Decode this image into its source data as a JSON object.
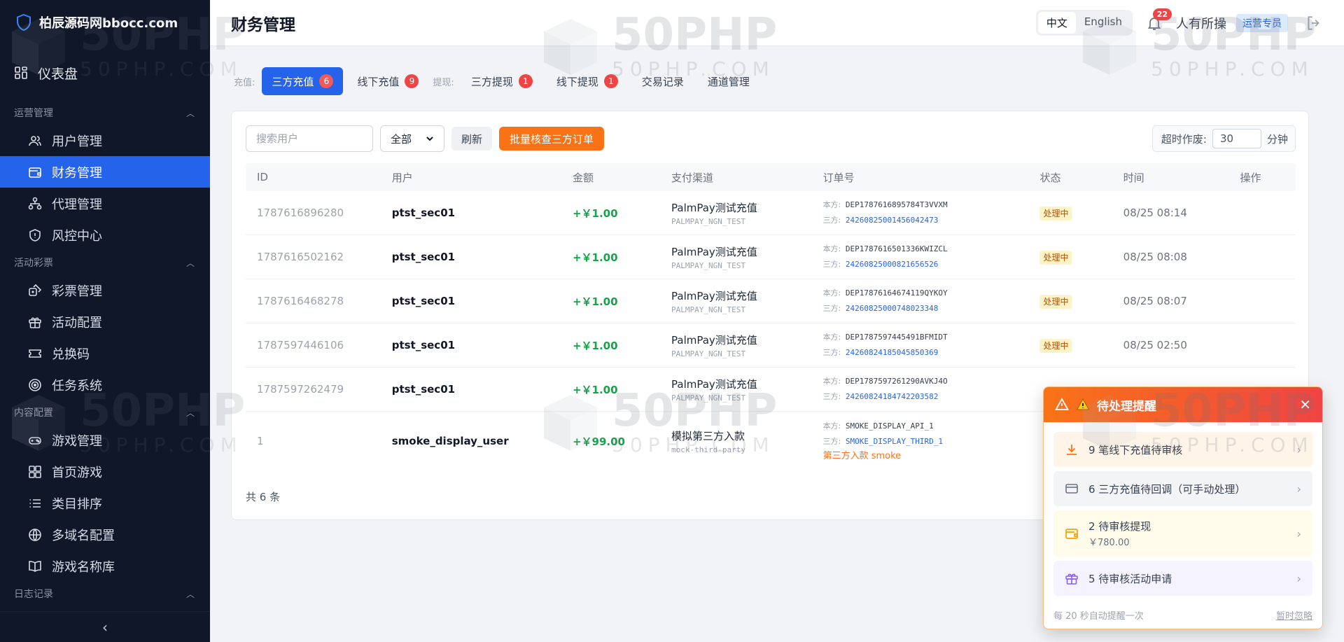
{
  "brand": {
    "name": "柏辰源码网bbocc.com"
  },
  "sidebar": {
    "dashboard": "仪表盘",
    "sections": [
      {
        "title": "运营管理",
        "items": [
          "用户管理",
          "财务管理",
          "代理管理",
          "风控中心"
        ]
      },
      {
        "title": "活动彩票",
        "items": [
          "彩票管理",
          "活动配置",
          "兑换码",
          "任务系统"
        ]
      },
      {
        "title": "内容配置",
        "items": [
          "游戏管理",
          "首页游戏",
          "类目排序",
          "多域名配置",
          "游戏名称库"
        ]
      },
      {
        "title": "日志记录",
        "items": []
      }
    ],
    "active_item": "财务管理",
    "collapse_icon": "‹"
  },
  "header": {
    "title": "财务管理",
    "lang_zh": "中文",
    "lang_en": "English",
    "notification_count": "22",
    "username": "人有所操",
    "role": "运营专员"
  },
  "tabs": {
    "recharge_label": "充值:",
    "withdraw_label": "提现:",
    "items": [
      {
        "label": "三方充值",
        "badge": "6"
      },
      {
        "label": "线下充值",
        "badge": "9"
      },
      {
        "label": "三方提现",
        "badge": "1"
      },
      {
        "label": "线下提现",
        "badge": "1"
      },
      {
        "label": "交易记录"
      },
      {
        "label": "通道管理"
      }
    ]
  },
  "toolbar": {
    "search_placeholder": "搜索用户",
    "filter_value": "全部",
    "refresh": "刷新",
    "batch_check": "批量核查三方订单",
    "timeout_label": "超时作废:",
    "timeout_value": "30",
    "timeout_unit": "分钟"
  },
  "table": {
    "columns": [
      "ID",
      "用户",
      "金额",
      "支付渠道",
      "订单号",
      "状态",
      "时间",
      "操作"
    ],
    "rows": [
      {
        "id": "1787616896280",
        "user": "ptst_sec01",
        "amount": "+￥1.00",
        "channel": "PalmPay测试充值",
        "channel_code": "PALMPAY_NGN_TEST",
        "own_prefix": "本方:",
        "own_order": "DEP1787616895784T3VVXM",
        "third_prefix": "三方:",
        "third_order": "24260825001456042473",
        "status": "处理中",
        "time": "08/25 08:14"
      },
      {
        "id": "1787616502162",
        "user": "ptst_sec01",
        "amount": "+￥1.00",
        "channel": "PalmPay测试充值",
        "channel_code": "PALMPAY_NGN_TEST",
        "own_prefix": "本方:",
        "own_order": "DEP1787616501336KWIZCL",
        "third_prefix": "三方:",
        "third_order": "24260825000821656526",
        "status": "处理中",
        "time": "08/25 08:08"
      },
      {
        "id": "1787616468278",
        "user": "ptst_sec01",
        "amount": "+￥1.00",
        "channel": "PalmPay测试充值",
        "channel_code": "PALMPAY_NGN_TEST",
        "own_prefix": "本方:",
        "own_order": "DEP17876164674119QYKOY",
        "third_prefix": "三方:",
        "third_order": "24260825000748023348",
        "status": "处理中",
        "time": "08/25 08:07"
      },
      {
        "id": "1787597446106",
        "user": "ptst_sec01",
        "amount": "+￥1.00",
        "channel": "PalmPay测试充值",
        "channel_code": "PALMPAY_NGN_TEST",
        "own_prefix": "本方:",
        "own_order": "DEP1787597445491BFMIDT",
        "third_prefix": "三方:",
        "third_order": "24260824185045850369",
        "status": "处理中",
        "time": "08/25 02:50"
      },
      {
        "id": "1787597262479",
        "user": "ptst_sec01",
        "amount": "+￥1.00",
        "channel": "PalmPay测试充值",
        "channel_code": "PALMPAY_NGN_TEST",
        "own_prefix": "本方:",
        "own_order": "DEP1787597261290AVKJ4O",
        "third_prefix": "三方:",
        "third_order": "24260824184742203582",
        "status": "",
        "time": ""
      },
      {
        "id": "1",
        "user": "smoke_display_user",
        "amount": "+￥99.00",
        "channel": "模拟第三方入款",
        "channel_code": "mock-third-party",
        "own_prefix": "本方:",
        "own_order": "SMOKE_DISPLAY_API_1",
        "third_prefix": "三方:",
        "third_order": "SMOKE_DISPLAY_THIRD_1",
        "note": "第三方入款 smoke",
        "status": "",
        "time": ""
      }
    ],
    "total": "共 6 条"
  },
  "notify": {
    "title": "待处理提醒",
    "items": [
      {
        "text": "9 笔线下充值待审核"
      },
      {
        "text": "6 三方充值待回调（可手动处理）"
      },
      {
        "text": "2 待审核提现",
        "sub": "￥780.00"
      },
      {
        "text": "5 待审核活动申请"
      }
    ],
    "footer_left": "每 20 秒自动提醒一次",
    "footer_right": "暂时忽略"
  },
  "watermark": {
    "big": "50PHP",
    "small": "50PHP.COM"
  },
  "colors": {
    "primary": "#2563eb",
    "sidebar": "#0f1729",
    "accent_orange": "#f97316",
    "success": "#16a34a",
    "danger": "#ef4444"
  }
}
